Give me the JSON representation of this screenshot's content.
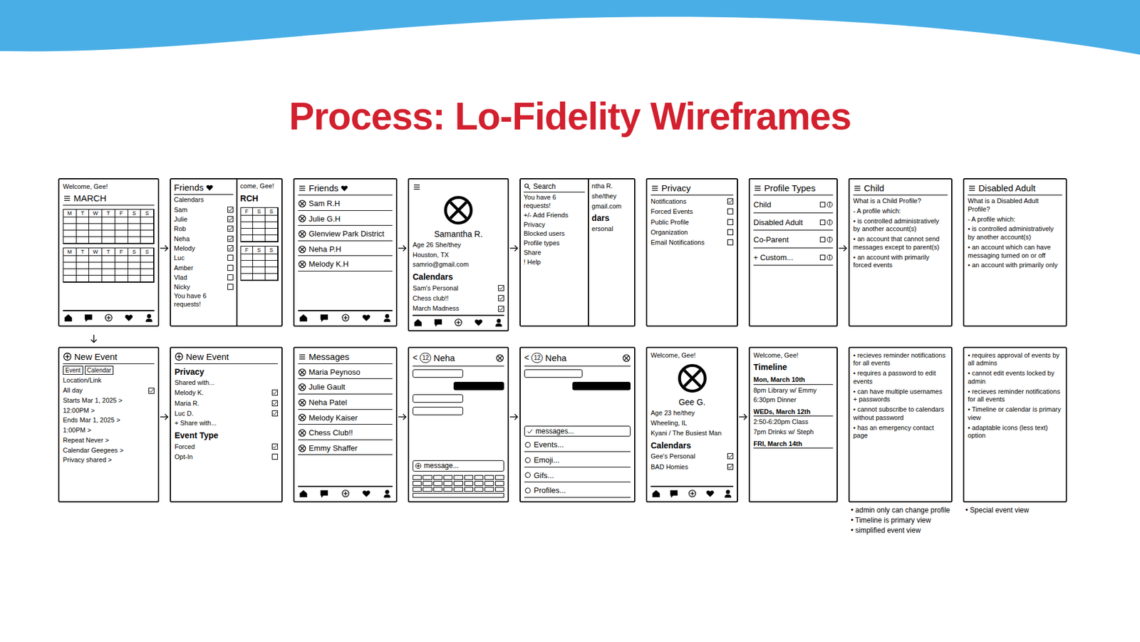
{
  "slide": {
    "title": "Process: Lo-Fidelity Wireframes"
  },
  "rows": [
    {
      "frames": [
        {
          "kind": "plain",
          "lines": [
            {
              "kind": "text",
              "text": "Welcome, Gee!"
            },
            {
              "kind": "menuhead",
              "text": "MARCH"
            },
            {
              "kind": "cal",
              "days": [
                "M",
                "T",
                "W",
                "T",
                "F",
                "S",
                "S"
              ]
            },
            {
              "kind": "cal",
              "days": [
                "M",
                "T",
                "W",
                "T",
                "F",
                "S",
                "S"
              ]
            },
            {
              "kind": "nav"
            }
          ]
        },
        {
          "kind": "split",
          "panel": [
            {
              "kind": "hearthead",
              "text": "Friends"
            },
            {
              "kind": "text",
              "text": "Calendars"
            },
            {
              "kind": "check",
              "text": "Sam",
              "checked": true
            },
            {
              "kind": "check",
              "text": "Julie",
              "checked": true
            },
            {
              "kind": "check",
              "text": "Rob",
              "checked": true
            },
            {
              "kind": "check",
              "text": "Neha",
              "checked": true
            },
            {
              "kind": "check",
              "text": "Melody",
              "checked": true
            },
            {
              "kind": "check",
              "text": "Luc",
              "checked": false
            },
            {
              "kind": "check",
              "text": "Amber",
              "checked": false
            },
            {
              "kind": "check",
              "text": "Vlad",
              "checked": false
            },
            {
              "kind": "check",
              "text": "Nicky",
              "checked": false
            },
            {
              "kind": "text",
              "text": "You have 6 requests!"
            }
          ],
          "rest": [
            {
              "kind": "text",
              "text": "come, Gee!"
            },
            {
              "kind": "head",
              "text": "RCH"
            },
            {
              "kind": "cal",
              "days": [
                "F",
                "S",
                "S"
              ]
            },
            {
              "kind": "cal",
              "days": [
                "F",
                "S",
                "S"
              ]
            }
          ]
        },
        {
          "kind": "plain",
          "lines": [
            {
              "kind": "menuhearthead",
              "text": "Friends"
            },
            {
              "kind": "person",
              "text": "Sam R.H"
            },
            {
              "kind": "person",
              "text": "Julie G.H"
            },
            {
              "kind": "person",
              "text": "Glenview Park District"
            },
            {
              "kind": "person",
              "text": "Neha P.H"
            },
            {
              "kind": "person",
              "text": "Melody K.H"
            },
            {
              "kind": "nav"
            }
          ]
        },
        {
          "kind": "plain",
          "lines": [
            {
              "kind": "menu"
            },
            {
              "kind": "avatar"
            },
            {
              "kind": "name",
              "text": "Samantha R."
            },
            {
              "kind": "text",
              "text": "Age 26   She/they"
            },
            {
              "kind": "text",
              "text": "Houston, TX"
            },
            {
              "kind": "text",
              "text": "samrio@gmail.com"
            },
            {
              "kind": "head",
              "text": "Calendars"
            },
            {
              "kind": "check",
              "text": "Sam's Personal",
              "checked": true
            },
            {
              "kind": "check",
              "text": "Chess club!!",
              "checked": true
            },
            {
              "kind": "check",
              "text": "March Madness",
              "checked": true
            },
            {
              "kind": "nav"
            }
          ]
        },
        {
          "kind": "split",
          "panel": [
            {
              "kind": "search",
              "text": "Search"
            },
            {
              "kind": "text",
              "text": "You have 6 requests!"
            },
            {
              "kind": "text",
              "text": "+/- Add Friends"
            },
            {
              "kind": "text",
              "text": "Privacy"
            },
            {
              "kind": "text",
              "text": "Blocked users"
            },
            {
              "kind": "text",
              "text": "Profile types"
            },
            {
              "kind": "text",
              "text": "Share"
            },
            {
              "kind": "text",
              "text": "! Help"
            }
          ],
          "rest": [
            {
              "kind": "text",
              "text": "ntha R."
            },
            {
              "kind": "text",
              "text": "she/they"
            },
            {
              "kind": "text",
              "text": "gmail.com"
            },
            {
              "kind": "head",
              "text": "dars"
            },
            {
              "kind": "text",
              "text": "ersonal"
            }
          ]
        },
        {
          "kind": "plain",
          "lines": [
            {
              "kind": "menuhead",
              "text": "Privacy"
            },
            {
              "kind": "check",
              "text": "Notifications",
              "checked": true
            },
            {
              "kind": "check",
              "text": "Forced Events",
              "checked": false
            },
            {
              "kind": "check",
              "text": "Public Profile",
              "checked": false
            },
            {
              "kind": "check",
              "text": "Organization",
              "checked": false
            },
            {
              "kind": "check",
              "text": "Email Notifications",
              "checked": false
            }
          ]
        },
        {
          "kind": "plain",
          "lines": [
            {
              "kind": "menuhead",
              "text": "Profile Types"
            },
            {
              "kind": "option",
              "text": "Child"
            },
            {
              "kind": "option",
              "text": "Disabled Adult"
            },
            {
              "kind": "option",
              "text": "Co-Parent"
            },
            {
              "kind": "option",
              "text": "+ Custom..."
            }
          ]
        },
        {
          "kind": "plain",
          "lines": [
            {
              "kind": "menuhead",
              "text": "Child"
            },
            {
              "kind": "text",
              "text": "What is a Child Profile?"
            },
            {
              "kind": "text",
              "text": "- A profile which:"
            },
            {
              "kind": "text",
              "text": "• is controlled administratively by another account(s)"
            },
            {
              "kind": "text",
              "text": "• an account that cannot send messages except to parent(s)"
            },
            {
              "kind": "text",
              "text": "• an account with primarily forced events"
            }
          ]
        },
        {
          "kind": "plain",
          "lines": [
            {
              "kind": "menuhead",
              "text": "Disabled Adult"
            },
            {
              "kind": "text",
              "text": "What is a Disabled Adult Profile?"
            },
            {
              "kind": "text",
              "text": "- A profile which:"
            },
            {
              "kind": "text",
              "text": "• is controlled administratively by another account(s)"
            },
            {
              "kind": "text",
              "text": "• an account which can have messaging turned on or off"
            },
            {
              "kind": "text",
              "text": "• an account with primarily only"
            }
          ]
        }
      ]
    },
    {
      "frames": [
        {
          "kind": "plain",
          "lines": [
            {
              "kind": "plushead",
              "text": "New Event"
            },
            {
              "kind": "tabs",
              "tabs": [
                "Event",
                "Calendar"
              ]
            },
            {
              "kind": "text",
              "text": "Location/Link"
            },
            {
              "kind": "check",
              "text": "All day",
              "checked": true
            },
            {
              "kind": "text",
              "text": "Starts  Mar 1, 2025 >"
            },
            {
              "kind": "text",
              "text": "12:00PM >"
            },
            {
              "kind": "text",
              "text": "Ends  Mar 1, 2025 >"
            },
            {
              "kind": "text",
              "text": "1:00PM >"
            },
            {
              "kind": "text",
              "text": "Repeat  Never >"
            },
            {
              "kind": "text",
              "text": "Calendar  Geegees >"
            },
            {
              "kind": "text",
              "text": "Privacy  shared >"
            }
          ]
        },
        {
          "kind": "plain",
          "lines": [
            {
              "kind": "plushead",
              "text": "New Event"
            },
            {
              "kind": "head",
              "text": "Privacy"
            },
            {
              "kind": "text",
              "text": "Shared with..."
            },
            {
              "kind": "check",
              "text": "Melody K.",
              "checked": true
            },
            {
              "kind": "check",
              "text": "Maria R.",
              "checked": true
            },
            {
              "kind": "check",
              "text": "Luc D.",
              "checked": true
            },
            {
              "kind": "text",
              "text": "+ Share with..."
            },
            {
              "kind": "head",
              "text": "Event Type"
            },
            {
              "kind": "check",
              "text": "Forced",
              "checked": true
            },
            {
              "kind": "check",
              "text": "Opt-In",
              "checked": false
            }
          ]
        },
        {
          "kind": "plain",
          "lines": [
            {
              "kind": "menuhead",
              "text": "Messages"
            },
            {
              "kind": "person",
              "text": "Maria Peynoso"
            },
            {
              "kind": "person",
              "text": "Julie Gault"
            },
            {
              "kind": "person",
              "text": "Neha Patel"
            },
            {
              "kind": "person",
              "text": "Melody Kaiser"
            },
            {
              "kind": "person",
              "text": "Chess Club!!"
            },
            {
              "kind": "person",
              "text": "Emmy Shaffer"
            },
            {
              "kind": "nav"
            }
          ]
        },
        {
          "kind": "plain",
          "lines": [
            {
              "kind": "chathead",
              "back": "<",
              "count": "12",
              "text": "Neha"
            },
            {
              "kind": "bubble",
              "side": "left",
              "dark": false
            },
            {
              "kind": "bubble",
              "side": "right",
              "dark": true
            },
            {
              "kind": "bubble",
              "side": "left",
              "dark": false
            },
            {
              "kind": "bubble",
              "side": "left",
              "dark": false
            },
            {
              "kind": "field",
              "text": "message..."
            },
            {
              "kind": "keys"
            }
          ]
        },
        {
          "kind": "plain",
          "lines": [
            {
              "kind": "chathead",
              "back": "<",
              "count": "12",
              "text": "Neha"
            },
            {
              "kind": "bubble",
              "side": "left",
              "dark": false
            },
            {
              "kind": "bubble",
              "side": "right",
              "dark": true
            },
            {
              "kind": "checkfield",
              "text": "messages..."
            },
            {
              "kind": "action",
              "text": "Events..."
            },
            {
              "kind": "action",
              "text": "Emoji..."
            },
            {
              "kind": "action",
              "text": "Gifs..."
            },
            {
              "kind": "action",
              "text": "Profiles..."
            }
          ]
        },
        {
          "kind": "plain",
          "lines": [
            {
              "kind": "text",
              "text": "Welcome, Gee!"
            },
            {
              "kind": "avatar"
            },
            {
              "kind": "name",
              "text": "Gee G."
            },
            {
              "kind": "text",
              "text": "Age 23   he/they"
            },
            {
              "kind": "text",
              "text": "Wheeling, IL"
            },
            {
              "kind": "text",
              "text": "Kyani / The Busiest Man"
            },
            {
              "kind": "head",
              "text": "Calendars"
            },
            {
              "kind": "check",
              "text": "Gee's Personal",
              "checked": true
            },
            {
              "kind": "check",
              "text": "BAD Homies",
              "checked": true
            },
            {
              "kind": "nav"
            }
          ]
        },
        {
          "kind": "plain",
          "lines": [
            {
              "kind": "text",
              "text": "Welcome, Gee!"
            },
            {
              "kind": "head",
              "text": "Timeline"
            },
            {
              "kind": "date",
              "text": "Mon, March 10th"
            },
            {
              "kind": "text",
              "text": "8pm Library w/ Emmy"
            },
            {
              "kind": "text",
              "text": "6:30pm Dinner"
            },
            {
              "kind": "date",
              "text": "WEDs, March 12th"
            },
            {
              "kind": "text",
              "text": "2:50-6:20pm Class"
            },
            {
              "kind": "text",
              "text": "7pm Drinks w/ Steph"
            },
            {
              "kind": "date",
              "text": "FRI, March 14th"
            }
          ]
        },
        {
          "kind": "plain",
          "lines": [
            {
              "kind": "text",
              "text": "• recieves reminder notifications for all events"
            },
            {
              "kind": "text",
              "text": "• requires a password to edit events"
            },
            {
              "kind": "text",
              "text": "• can have multiple usernames + passwords"
            },
            {
              "kind": "text",
              "text": "• cannot subscribe to calendars without password"
            },
            {
              "kind": "text",
              "text": "• has an emergency contact page"
            }
          ],
          "after": [
            {
              "kind": "text",
              "text": "• admin only can change profile"
            },
            {
              "kind": "text",
              "text": "• Timeline is primary view"
            },
            {
              "kind": "text",
              "text": "• simplified event view"
            }
          ]
        },
        {
          "kind": "plain",
          "lines": [
            {
              "kind": "text",
              "text": "• requires approval of events by all admins"
            },
            {
              "kind": "text",
              "text": "• cannot edit events locked by admin"
            },
            {
              "kind": "text",
              "text": "• recieves reminder notifications for all events"
            },
            {
              "kind": "text",
              "text": "• Timeline or calendar is primary view"
            },
            {
              "kind": "text",
              "text": "• adaptable icons (less text) option"
            }
          ],
          "after": [
            {
              "kind": "text",
              "text": "• Special event view"
            }
          ]
        }
      ]
    }
  ]
}
